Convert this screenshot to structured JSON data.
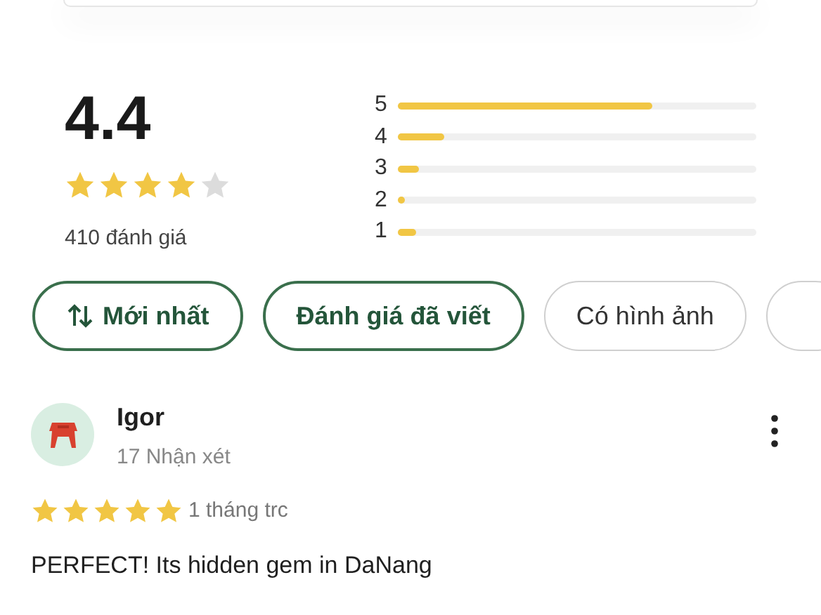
{
  "summary": {
    "rating": "4.4",
    "stars": 4,
    "count": "410 đánh giá"
  },
  "histogram": [
    {
      "label": "5",
      "level": 0.71
    },
    {
      "label": "4",
      "level": 0.13
    },
    {
      "label": "3",
      "level": 0.06
    },
    {
      "label": "2",
      "level": 0.02
    },
    {
      "label": "1",
      "level": 0.05
    }
  ],
  "filters": [
    {
      "label": "Mới nhất",
      "selected": true,
      "kind": "sort"
    },
    {
      "label": "Đánh giá đã viết",
      "selected": true,
      "kind": "filter"
    },
    {
      "label": "Có hình ảnh",
      "selected": false,
      "kind": "filter"
    },
    {
      "selected": false,
      "kind": "filter"
    }
  ],
  "review": {
    "author": "Igor",
    "reviews": "17 Nhận xét",
    "stars": 5,
    "time": "1 tháng trc",
    "text": "PERFECT! Its hidden gem in DaNang"
  }
}
